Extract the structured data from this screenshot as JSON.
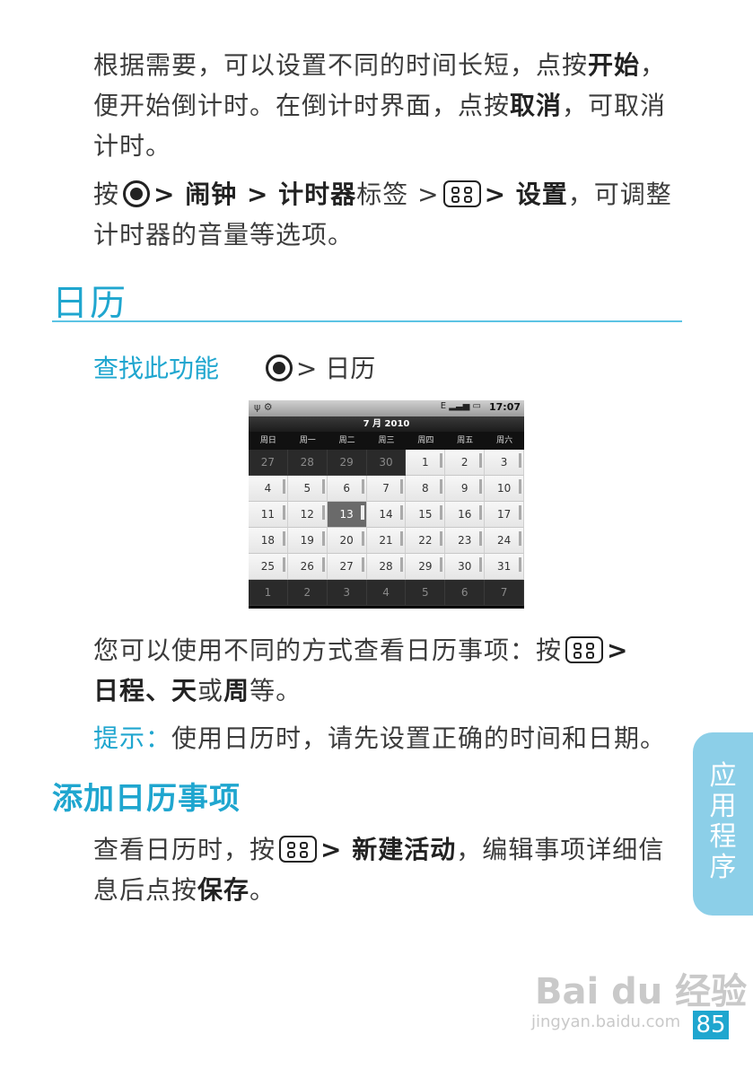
{
  "para1": {
    "text": "根据需要，可以设置不同的时间长短，点按",
    "b1": "开始",
    "mid": "，便开始倒计时。在倒计时界面，点按",
    "b2": "取消",
    "end": "，可取消计时。"
  },
  "para2": {
    "pre": "按",
    "g1": "> 闹钟 > 计时器",
    "mid": "标签 >",
    "g2": "> 设置",
    "end": "，可调整计时器的音量等选项。"
  },
  "section_title": "日历",
  "find_feature": {
    "label": "查找此功能",
    "path": "> 日历"
  },
  "phone": {
    "time": "17:07",
    "left_icons": "ψ ⚙",
    "right_icons": "E ▂▃▅ ▭",
    "month": "7 月 2010",
    "weekdays": [
      "周日",
      "周一",
      "周二",
      "周三",
      "周四",
      "周五",
      "周六"
    ],
    "weeks": [
      [
        "27",
        "28",
        "29",
        "30",
        "1",
        "2",
        "3"
      ],
      [
        "4",
        "5",
        "6",
        "7",
        "8",
        "9",
        "10"
      ],
      [
        "11",
        "12",
        "13",
        "14",
        "15",
        "16",
        "17"
      ],
      [
        "18",
        "19",
        "20",
        "21",
        "22",
        "23",
        "24"
      ],
      [
        "25",
        "26",
        "27",
        "28",
        "29",
        "30",
        "31"
      ],
      [
        "1",
        "2",
        "3",
        "4",
        "5",
        "6",
        "7"
      ]
    ]
  },
  "para3": {
    "pre": "您可以使用不同的方式查看日历事项：按",
    "gt": ">",
    "b1": "日程",
    "s1": "、",
    "b2": "天",
    "s2": "或",
    "b3": "周",
    "end": "等。"
  },
  "tip": {
    "label": "提示：",
    "text": "使用日历时，请先设置正确的时间和日期。"
  },
  "subsection_title": "添加日历事项",
  "para4": {
    "pre": "查看日历时，按",
    "b1": "> 新建活动",
    "mid": "，编辑事项详细信息后点按",
    "b2": "保存",
    "end": "。"
  },
  "side_tab": "应用程序",
  "page_number": "85",
  "watermark": "Bai du 经验",
  "watermark_url": "jingyan.baidu.com"
}
